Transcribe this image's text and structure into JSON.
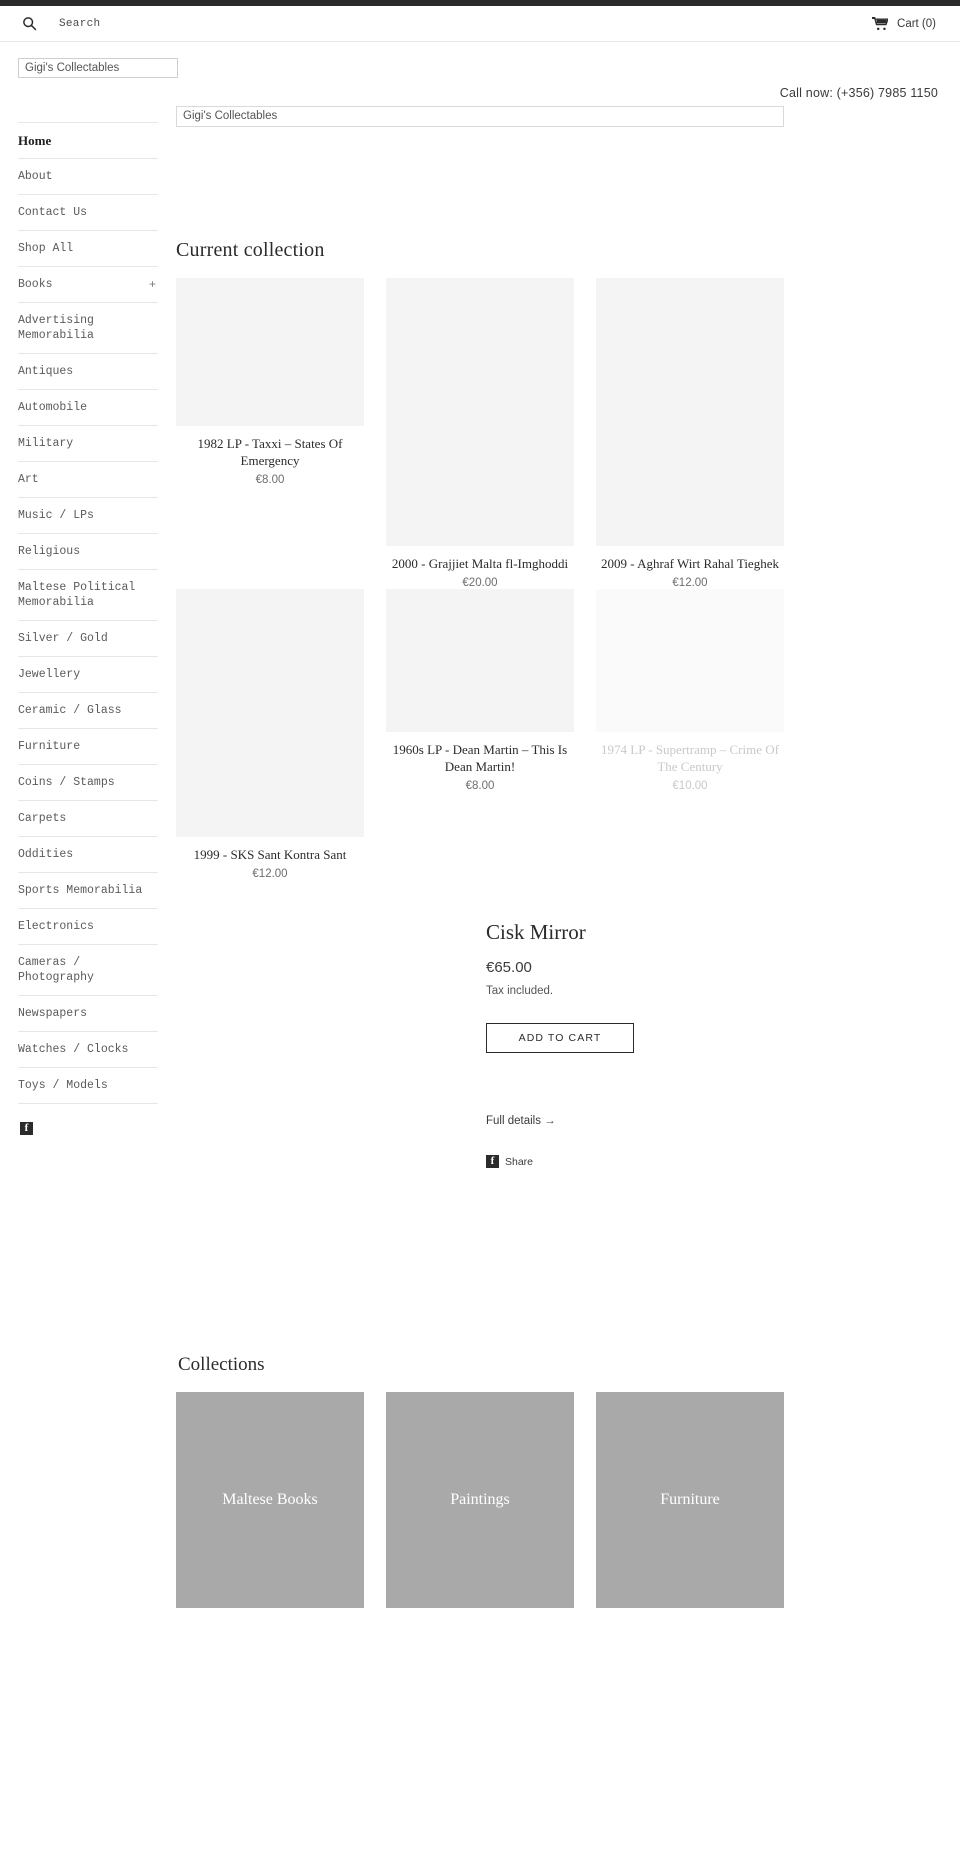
{
  "topbar": {
    "present": true
  },
  "utility": {
    "search_placeholder": "Search",
    "cart_label": "Cart (0)"
  },
  "brand": {
    "logo_alt_text": "Gigi's Collectables",
    "call_now": "Call now: (+356) 7985 1150"
  },
  "sidebar": {
    "items": [
      {
        "label": "Home",
        "active": true,
        "plus": ""
      },
      {
        "label": "About",
        "active": false,
        "plus": ""
      },
      {
        "label": "Contact Us",
        "active": false,
        "plus": ""
      },
      {
        "label": "Shop All",
        "active": false,
        "plus": ""
      },
      {
        "label": "Books",
        "active": false,
        "plus": "+"
      },
      {
        "label": "Advertising Memorabilia",
        "active": false,
        "plus": ""
      },
      {
        "label": "Antiques",
        "active": false,
        "plus": ""
      },
      {
        "label": "Automobile",
        "active": false,
        "plus": ""
      },
      {
        "label": "Military",
        "active": false,
        "plus": ""
      },
      {
        "label": "Art",
        "active": false,
        "plus": ""
      },
      {
        "label": "Music / LPs",
        "active": false,
        "plus": ""
      },
      {
        "label": "Religious",
        "active": false,
        "plus": ""
      },
      {
        "label": "Maltese Political Memorabilia",
        "active": false,
        "plus": ""
      },
      {
        "label": "Silver / Gold",
        "active": false,
        "plus": ""
      },
      {
        "label": "Jewellery",
        "active": false,
        "plus": ""
      },
      {
        "label": "Ceramic / Glass",
        "active": false,
        "plus": ""
      },
      {
        "label": "Furniture",
        "active": false,
        "plus": ""
      },
      {
        "label": "Coins / Stamps",
        "active": false,
        "plus": ""
      },
      {
        "label": "Carpets",
        "active": false,
        "plus": ""
      },
      {
        "label": "Oddities",
        "active": false,
        "plus": ""
      },
      {
        "label": "Sports Memorabilia",
        "active": false,
        "plus": ""
      },
      {
        "label": "Electronics",
        "active": false,
        "plus": ""
      },
      {
        "label": "Cameras / Photography",
        "active": false,
        "plus": ""
      },
      {
        "label": "Newspapers",
        "active": false,
        "plus": ""
      },
      {
        "label": "Watches / Clocks",
        "active": false,
        "plus": ""
      },
      {
        "label": "Toys / Models",
        "active": false,
        "plus": ""
      }
    ],
    "social": {
      "facebook_label": "f"
    }
  },
  "main": {
    "banner_alt_text": "Gigi's Collectables",
    "collection_heading": "Current collection",
    "products": [
      {
        "title": "1982 LP - Taxxi – States Of Emergency",
        "price": "€8.00",
        "thumb_height": 148,
        "faded": false
      },
      {
        "title": "2000 - Grajjiet Malta fl-Imghoddi",
        "price": "€20.00",
        "thumb_height": 268,
        "faded": false
      },
      {
        "title": "2009 - Aghraf Wirt Rahal Tieghek",
        "price": "€12.00",
        "thumb_height": 268,
        "faded": false
      },
      {
        "title": "1999 - SKS Sant Kontra Sant",
        "price": "€12.00",
        "thumb_height": 248,
        "faded": false
      },
      {
        "title": "1960s LP - Dean Martin – This Is Dean Martin!",
        "price": "€8.00",
        "thumb_height": 143,
        "faded": false
      },
      {
        "title": "1974 LP - Supertramp – Crime Of The Century",
        "price": "€10.00",
        "thumb_height": 143,
        "faded": true
      }
    ],
    "featured": {
      "title": "Cisk Mirror",
      "price": "€65.00",
      "tax_note": "Tax included.",
      "add_to_cart_label": "Add to cart",
      "full_details_label": "Full details →",
      "share_label": "Share"
    },
    "collections_heading": "Collections",
    "collections": [
      {
        "name": "Maltese Books"
      },
      {
        "name": "Paintings"
      },
      {
        "name": "Furniture"
      }
    ]
  },
  "colors": {
    "topbar": "#2b2b2b",
    "thumb_bg": "#f4f4f4",
    "collection_tile": "#a9a9a9",
    "text": "#2b2b2b",
    "muted": "#6d6d6d"
  }
}
